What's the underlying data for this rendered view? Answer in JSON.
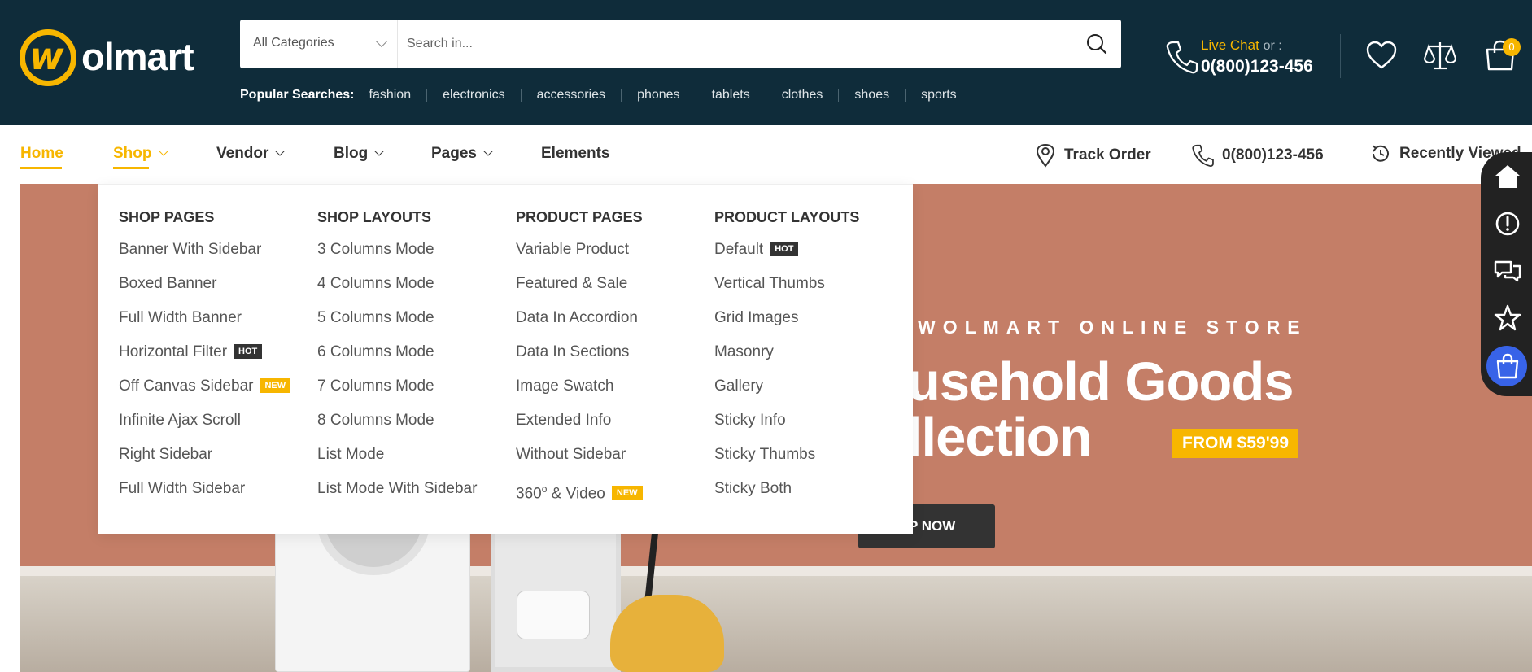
{
  "brand": {
    "logo_text": "olmart",
    "logo_letter": "w"
  },
  "search": {
    "category": "All Categories",
    "placeholder": "Search in..."
  },
  "popular": {
    "label": "Popular Searches:",
    "items": [
      "fashion",
      "electronics",
      "accessories",
      "phones",
      "tablets",
      "clothes",
      "shoes",
      "sports"
    ]
  },
  "contact": {
    "live_chat": "Live Chat",
    "or": "or :",
    "phone": "0(800)123-456"
  },
  "cart": {
    "count": "0"
  },
  "nav": {
    "items": [
      {
        "label": "Home"
      },
      {
        "label": "Shop"
      },
      {
        "label": "Vendor"
      },
      {
        "label": "Blog"
      },
      {
        "label": "Pages"
      },
      {
        "label": "Elements"
      }
    ],
    "track_order": "Track Order",
    "phone": "0(800)123-456",
    "recently_viewed": "Recently Viewed"
  },
  "megamenu": {
    "columns": [
      {
        "title": "SHOP PAGES",
        "items": [
          "Banner With Sidebar",
          "Boxed Banner",
          "Full Width Banner",
          "Horizontal Filter",
          "Off Canvas Sidebar",
          "Infinite Ajax Scroll",
          "Right Sidebar",
          "Full Width Sidebar"
        ]
      },
      {
        "title": "SHOP LAYOUTS",
        "items": [
          "3 Columns Mode",
          "4 Columns Mode",
          "5 Columns Mode",
          "6 Columns Mode",
          "7 Columns Mode",
          "8 Columns Mode",
          "List Mode",
          "List Mode With Sidebar"
        ]
      },
      {
        "title": "PRODUCT PAGES",
        "items": [
          "Variable Product",
          "Featured & Sale",
          "Data In Accordion",
          "Data In Sections",
          "Image Swatch",
          "Extended Info",
          "Without Sidebar",
          "360",
          "& Video"
        ]
      },
      {
        "title": "PRODUCT LAYOUTS",
        "items": [
          "Default",
          "Vertical Thumbs",
          "Grid Images",
          "Masonry",
          "Gallery",
          "Sticky Info",
          "Sticky Thumbs",
          "Sticky Both"
        ]
      }
    ],
    "badges": {
      "hot": "HOT",
      "new": "NEW"
    },
    "degree": "o"
  },
  "hero": {
    "eyebrow": "WOLMART ONLINE STORE",
    "title_line1": "ousehold Goods",
    "title_line2": "ollection",
    "price_badge": "FROM $59'99",
    "cta": "OP NOW"
  },
  "colors": {
    "accent": "#f7b600",
    "header_bg": "#0f2c3a",
    "hero_bg": "#c47e67",
    "float_active": "#3863e8"
  }
}
